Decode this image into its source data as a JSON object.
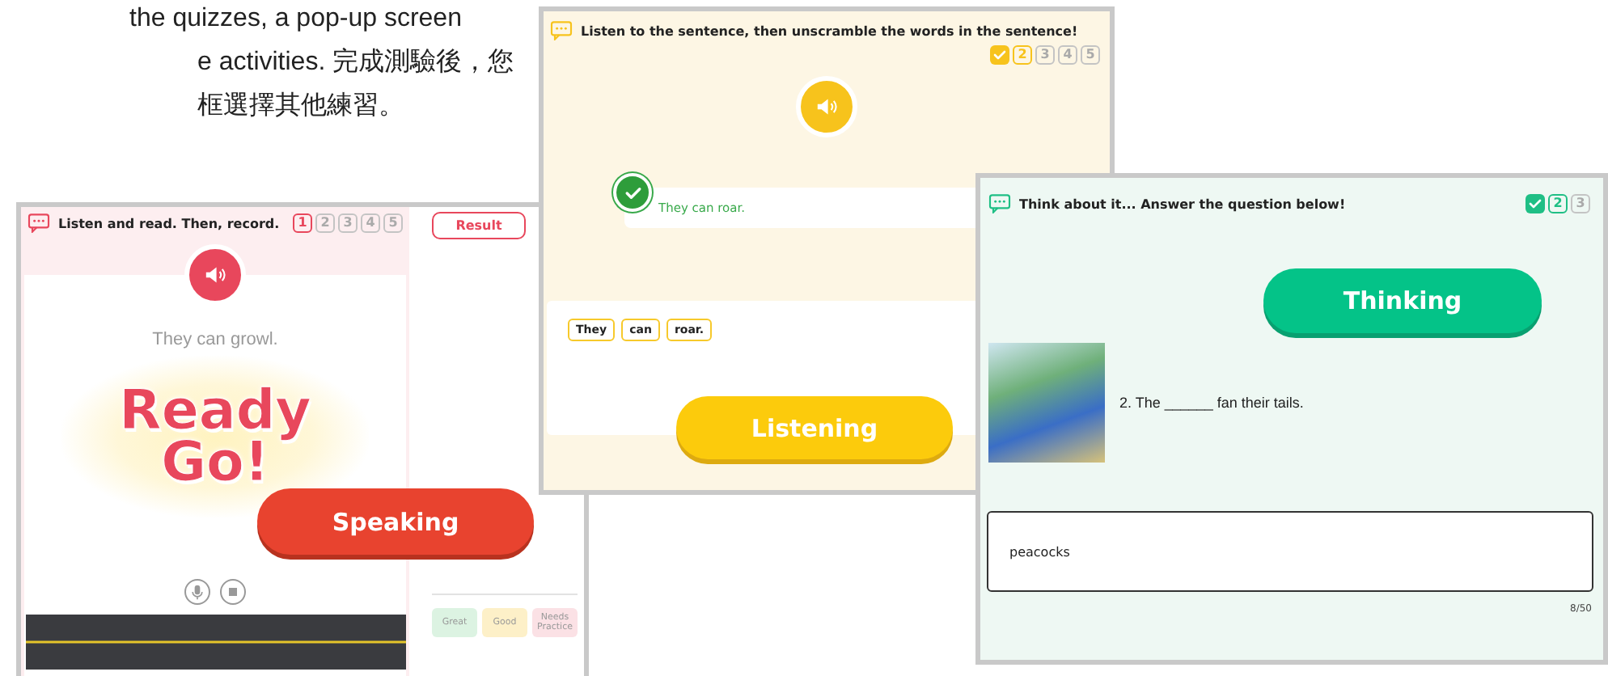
{
  "intro_lines": [
    "the quizzes, a pop-up screen",
    "e activities. 完成測驗後，您",
    "框選擇其他練習。"
  ],
  "speaking_panel": {
    "instruction": "Listen and read. Then, record.",
    "steps": [
      {
        "label": "1",
        "done": false,
        "selected": true
      },
      {
        "label": "2",
        "done": false,
        "selected": false
      },
      {
        "label": "3",
        "done": false,
        "selected": false
      },
      {
        "label": "4",
        "done": false,
        "selected": false
      },
      {
        "label": "5",
        "done": false,
        "selected": false
      }
    ],
    "result_button": "Result",
    "sentence": "They can growl.",
    "countdown": [
      "Ready",
      "Go!"
    ],
    "legend": [
      {
        "label": "Great",
        "color": "#dcf3e2"
      },
      {
        "label": "Good",
        "color": "#fdf0c8"
      },
      {
        "label": "Needs Practice",
        "color": "#fbe1e5"
      }
    ],
    "mode_button": "Speaking"
  },
  "listening_panel": {
    "instruction": "Listen to the sentence, then unscramble the words in the sentence!",
    "steps": [
      {
        "done": true
      },
      {
        "label": "2",
        "done": false,
        "selected": true
      },
      {
        "label": "3",
        "done": false,
        "selected": false
      },
      {
        "label": "4",
        "done": false,
        "selected": false
      },
      {
        "label": "5",
        "done": false,
        "selected": false
      }
    ],
    "answer": {
      "text": "They can roar.",
      "correct": true
    },
    "word_chips": [
      "They",
      "can",
      "roar."
    ],
    "mode_button": "Listening"
  },
  "thinking_panel": {
    "instruction": "Think about it... Answer the question below!",
    "steps": [
      {
        "done": true
      },
      {
        "label": "2",
        "done": false,
        "selected": true
      },
      {
        "label": "3",
        "done": false,
        "selected": false
      }
    ],
    "mode_button": "Thinking",
    "question": "2. The ______ fan their tails.",
    "answer_value": "peacocks",
    "char_count": "8/50"
  }
}
